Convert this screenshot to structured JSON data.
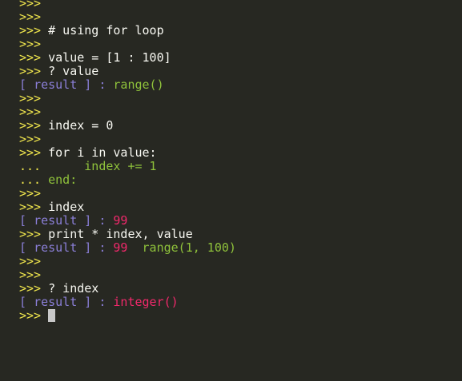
{
  "terminal": {
    "prompt": ">>>",
    "continuation": "...",
    "result_open": "[",
    "result_label": "result",
    "result_close": "]",
    "result_colon": ":",
    "lines": {
      "l0": "",
      "l1": "",
      "l2": "# using for loop",
      "l3": "",
      "l4": "value = [1 : 100]",
      "l5": "? value",
      "l6_value": "range()",
      "l7": "",
      "l8": "",
      "l9": "index = 0",
      "l10": "",
      "l11": "for i in value:",
      "l12": "     index += 1",
      "l13": "end:",
      "l14": "",
      "l15": "index",
      "l16_value": "99",
      "l17": "print * index, value",
      "l18_value_a": "99",
      "l18_value_b": "range(1, 100)",
      "l19": "",
      "l20": "",
      "l21": "? index",
      "l22_value": "integer()",
      "l23": ""
    }
  },
  "colors": {
    "background": "#272822",
    "prompt": "#f0e64d",
    "code": "#f8f8f2",
    "green": "#8fc23b",
    "result_label": "#8b7fd8",
    "magenta": "#f1286b"
  }
}
